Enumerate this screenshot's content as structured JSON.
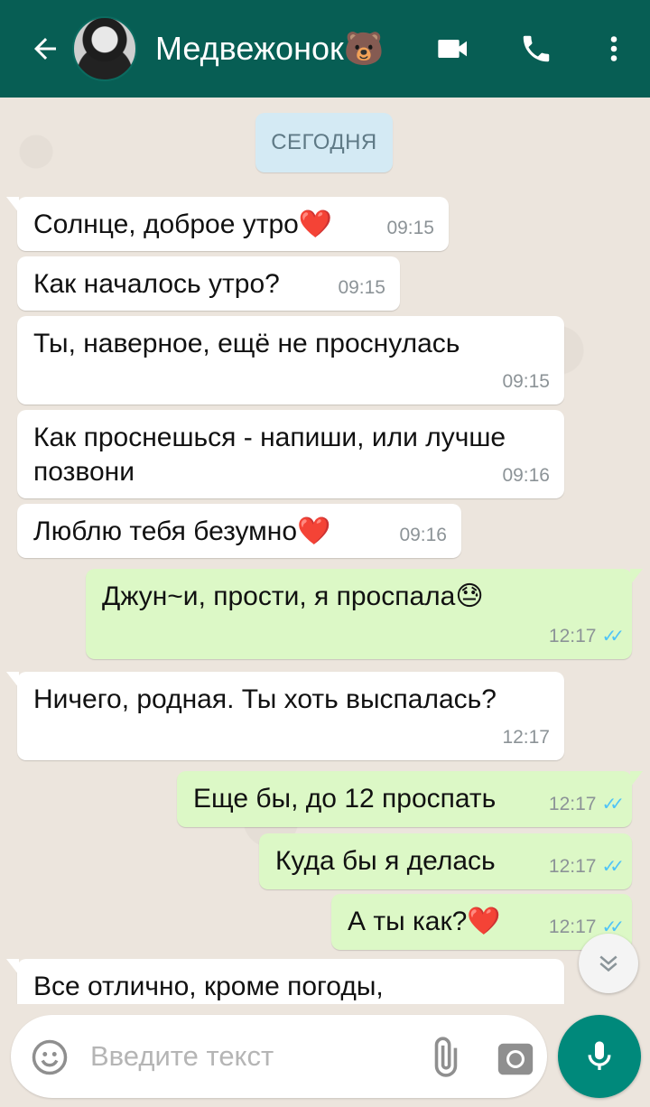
{
  "header": {
    "title": "Медвежонок🐻",
    "back_icon": "arrow-left-icon",
    "video_icon": "video-camera-icon",
    "call_icon": "phone-icon",
    "menu_icon": "more-vertical-icon"
  },
  "date_divider": "СЕГОДНЯ",
  "messages": [
    {
      "dir": "in",
      "text": "Солнце, доброе утро",
      "emoji": "❤️",
      "time": "09:15"
    },
    {
      "dir": "in",
      "text": "Как началось утро?",
      "time": "09:15"
    },
    {
      "dir": "in",
      "text": "Ты, наверное, ещё не проснулась",
      "time": "09:15"
    },
    {
      "dir": "in",
      "text": "Как проснешься - напиши, или лучше позвони",
      "time": "09:16"
    },
    {
      "dir": "in",
      "text": "Люблю тебя безумно",
      "emoji": "❤️",
      "time": "09:16"
    },
    {
      "dir": "out",
      "text": "Джун~и, прости, я проспала",
      "emoji": "😓",
      "time": "12:17",
      "status": "read"
    },
    {
      "dir": "in",
      "text": "Ничего, родная. Ты хоть выспалась?",
      "time": "12:17"
    },
    {
      "dir": "out",
      "text": "Еще бы, до 12 проспать",
      "time": "12:17",
      "status": "read"
    },
    {
      "dir": "out",
      "text": "Куда бы я делась",
      "time": "12:17",
      "status": "read"
    },
    {
      "dir": "out",
      "text": "А ты как?",
      "emoji": "❤️",
      "time": "12:17",
      "status": "read"
    },
    {
      "dir": "in",
      "text": "Все отлично, кроме погоды,"
    }
  ],
  "composer": {
    "placeholder": "Введите текст",
    "emoji_icon": "smiley-icon",
    "attach_icon": "paperclip-icon",
    "camera_icon": "camera-icon",
    "mic_icon": "microphone-icon"
  },
  "colors": {
    "header": "#075e54",
    "outgoing_bubble": "#dcf8c6",
    "incoming_bubble": "#ffffff",
    "read_ticks": "#4fc3f7",
    "fab": "#00897b"
  }
}
